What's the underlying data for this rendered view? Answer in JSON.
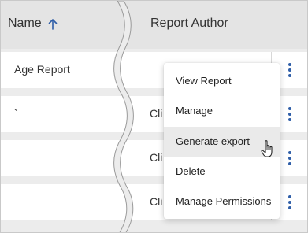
{
  "table": {
    "columns": {
      "name": "Name",
      "author": "Report Author"
    },
    "rows": [
      {
        "name": "Age Report",
        "author": ""
      },
      {
        "name": "`",
        "author": "Cli"
      },
      {
        "name": "",
        "author": "Cli"
      },
      {
        "name": "",
        "author": "Cli"
      }
    ]
  },
  "menu": {
    "items": [
      {
        "label": "View Report"
      },
      {
        "label": "Manage"
      },
      {
        "label": "Generate export",
        "hovered": true
      },
      {
        "label": "Delete"
      },
      {
        "label": "Manage Permissions"
      }
    ]
  },
  "icons": {
    "sort": "arrow-up-icon",
    "row_actions": "kebab-icon",
    "cursor": "hand-pointer-icon"
  },
  "colors": {
    "accent": "#2f5ea8",
    "header_bg": "#e4e4e4",
    "hover_bg": "#eaeaea"
  }
}
